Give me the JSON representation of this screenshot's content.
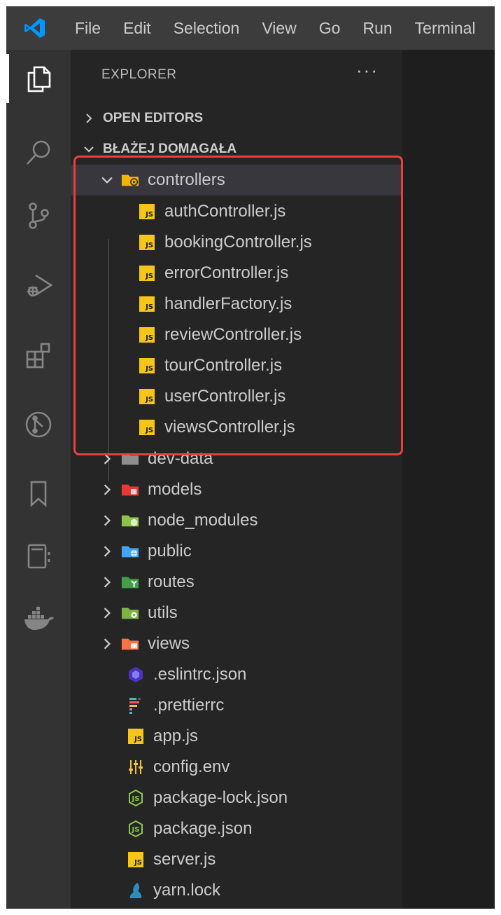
{
  "menu": [
    "File",
    "Edit",
    "Selection",
    "View",
    "Go",
    "Run",
    "Terminal"
  ],
  "explorer": {
    "title": "EXPLORER",
    "more": "···",
    "sections": {
      "open_editors": "OPEN EDITORS",
      "workspace": "BŁAŻEJ DOMAGAŁA"
    }
  },
  "controllers_folder": {
    "name": "controllers",
    "files": [
      "authController.js",
      "bookingController.js",
      "errorController.js",
      "handlerFactory.js",
      "reviewController.js",
      "tourController.js",
      "userController.js",
      "viewsController.js"
    ]
  },
  "folders": [
    {
      "name": "dev-data",
      "color": "#8e8e8e"
    },
    {
      "name": "models",
      "color": "#e53935"
    },
    {
      "name": "node_modules",
      "color": "#8bc34a"
    },
    {
      "name": "public",
      "color": "#42a5f5"
    },
    {
      "name": "routes",
      "color": "#43a047"
    },
    {
      "name": "utils",
      "color": "#7cb342"
    },
    {
      "name": "views",
      "color": "#ff7043"
    }
  ],
  "root_files": [
    {
      "name": ".eslintrc.json",
      "icon": "eslint-icon"
    },
    {
      "name": ".prettierrc",
      "icon": "prettier-icon"
    },
    {
      "name": "app.js",
      "icon": "js-file-icon"
    },
    {
      "name": "config.env",
      "icon": "settings-sliders-icon"
    },
    {
      "name": "package-lock.json",
      "icon": "nodejs-icon"
    },
    {
      "name": "package.json",
      "icon": "nodejs-icon"
    },
    {
      "name": "server.js",
      "icon": "js-file-icon"
    },
    {
      "name": "yarn.lock",
      "icon": "yarn-icon"
    }
  ],
  "colors": {
    "highlight": "#e8413c",
    "js_badge": "#f5c518",
    "vscode_blue": "#0098ff"
  }
}
